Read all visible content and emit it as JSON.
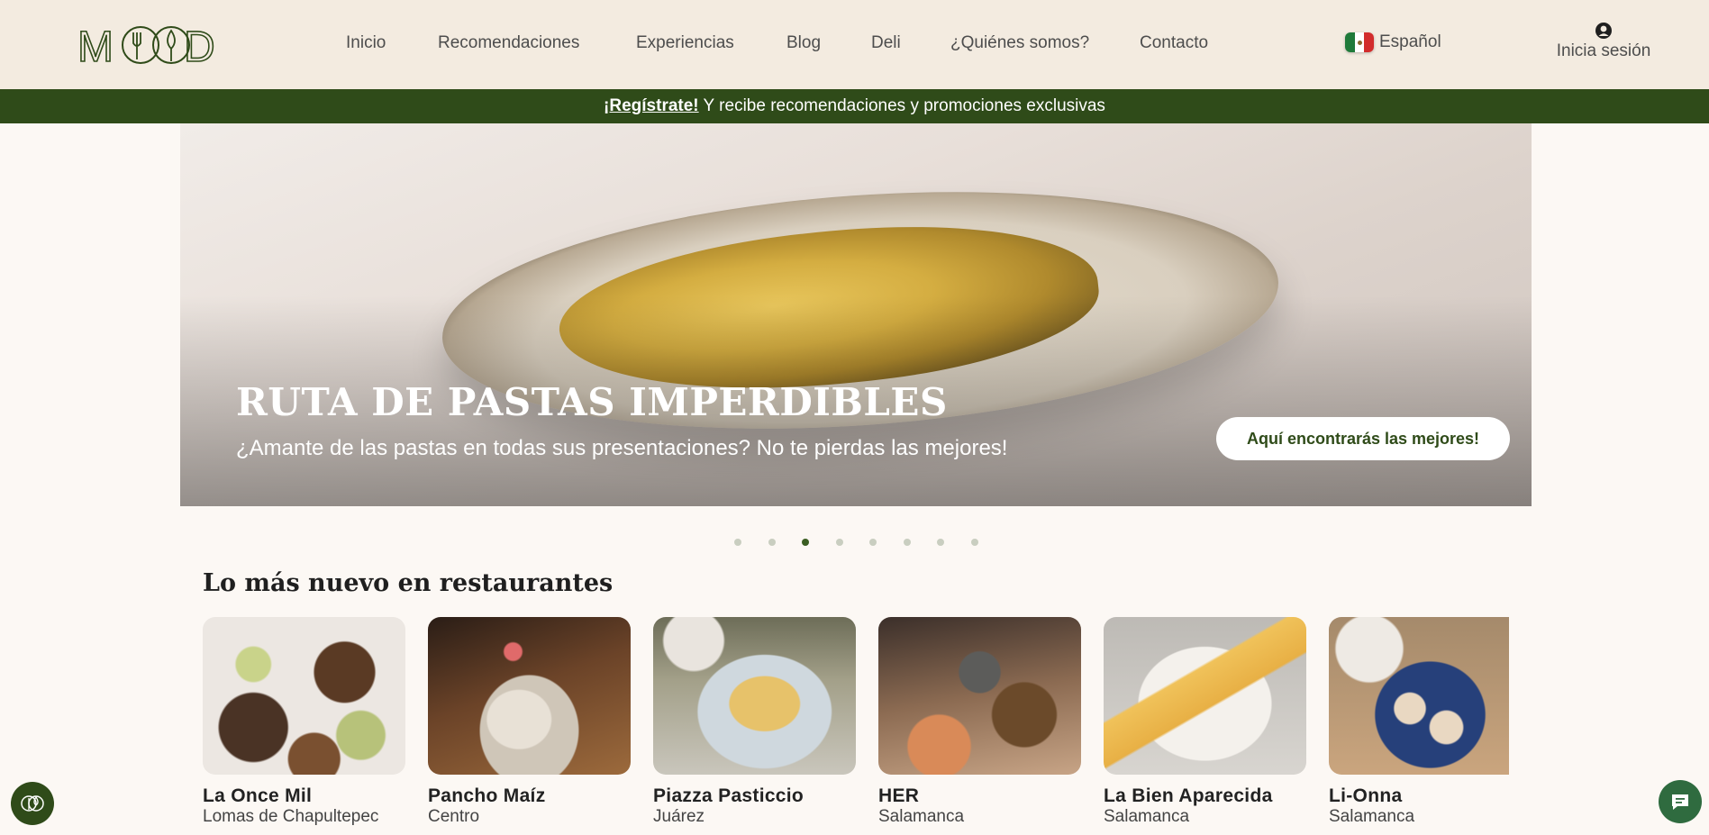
{
  "header": {
    "logo_text": "MOOD",
    "nav": [
      {
        "label": "Inicio"
      },
      {
        "label": "Recomendaciones"
      },
      {
        "label": "Experiencias"
      },
      {
        "label": "Blog"
      },
      {
        "label": "Deli"
      },
      {
        "label": "¿Quiénes somos?"
      },
      {
        "label": "Contacto"
      }
    ],
    "language": {
      "label": "Español",
      "flag_icon": "mexico-flag-icon"
    },
    "login": {
      "label": "Inicia sesión",
      "icon": "user-icon"
    }
  },
  "banner": {
    "link": "¡Regístrate!",
    "text": " Y recibe recomendaciones y promociones exclusivas"
  },
  "hero": {
    "title": "RUTA DE PASTAS IMPERDIBLES",
    "subtitle": "¿Amante de las pastas en todas sus presentaciones? No te pierdas las mejores!",
    "button": "Aquí encontrarás las mejores!",
    "slide_count": 8,
    "active_slide": 3
  },
  "section": {
    "title": "Lo más nuevo en restaurantes",
    "restaurants": [
      {
        "name": "La Once Mil",
        "location": "Lomas de Chapultepec"
      },
      {
        "name": "Pancho Maíz",
        "location": "Centro"
      },
      {
        "name": "Piazza Pasticcio",
        "location": "Juárez"
      },
      {
        "name": "HER",
        "location": "Salamanca"
      },
      {
        "name": "La Bien Aparecida",
        "location": "Salamanca"
      },
      {
        "name": "Li-Onna",
        "location": "Salamanca"
      }
    ]
  },
  "colors": {
    "brand_green": "#2f4b19",
    "header_bg": "#f3ebe0",
    "page_bg": "#fcf8f4",
    "active_dot": "#3b5e22",
    "inactive_dot": "#c9cec0"
  },
  "floating": {
    "left_icon": "mood-logo-icon",
    "right_icon": "chat-icon"
  }
}
